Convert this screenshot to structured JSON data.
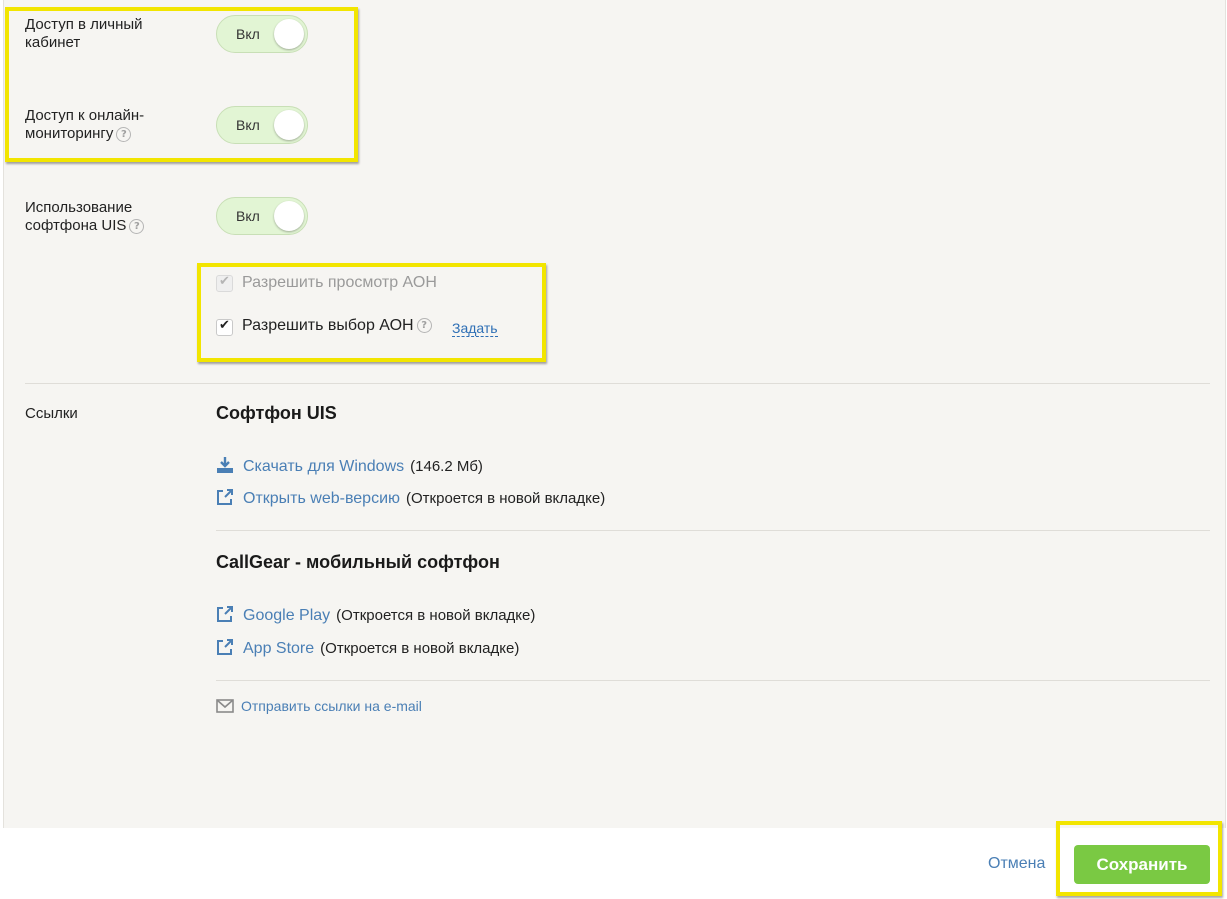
{
  "settings": {
    "personal_cabinet": {
      "label_line1": "Доступ в личный",
      "label_line2": "кабинет",
      "toggle": "Вкл"
    },
    "online_monitoring": {
      "label_line1": "Доступ к онлайн-",
      "label_line2": "мониторингу",
      "toggle": "Вкл"
    },
    "softphone_usage": {
      "label_line1": "Использование",
      "label_line2": "софтфона UIS",
      "toggle": "Вкл"
    }
  },
  "checkboxes": {
    "view_aon": {
      "label": "Разрешить просмотр АОН",
      "checked": true,
      "disabled": true
    },
    "choose_aon": {
      "label": "Разрешить выбор АОН",
      "checked": true,
      "link": "Задать"
    }
  },
  "links": {
    "section_label": "Ссылки",
    "softphone": {
      "title": "Софтфон UIS",
      "download_windows": "Скачать для Windows",
      "download_size": "(146.2 Мб)",
      "web_version": "Открыть web-версию",
      "web_note": "(Откроется в новой вкладке)"
    },
    "mobile": {
      "title": "CallGear - мобильный софтфон",
      "google_play": "Google Play",
      "google_note": "(Откроется в новой вкладке)",
      "app_store": "App Store",
      "app_note": "(Откроется в новой вкладке)"
    },
    "send_email": "Отправить ссылки на e-mail"
  },
  "footer": {
    "cancel": "Отмена",
    "save": "Сохранить"
  },
  "colors": {
    "accent_green": "#7ac943",
    "link_blue": "#4a7fb5",
    "highlight_yellow": "#f2e500",
    "toggle_bg": "#e2f5d4"
  }
}
